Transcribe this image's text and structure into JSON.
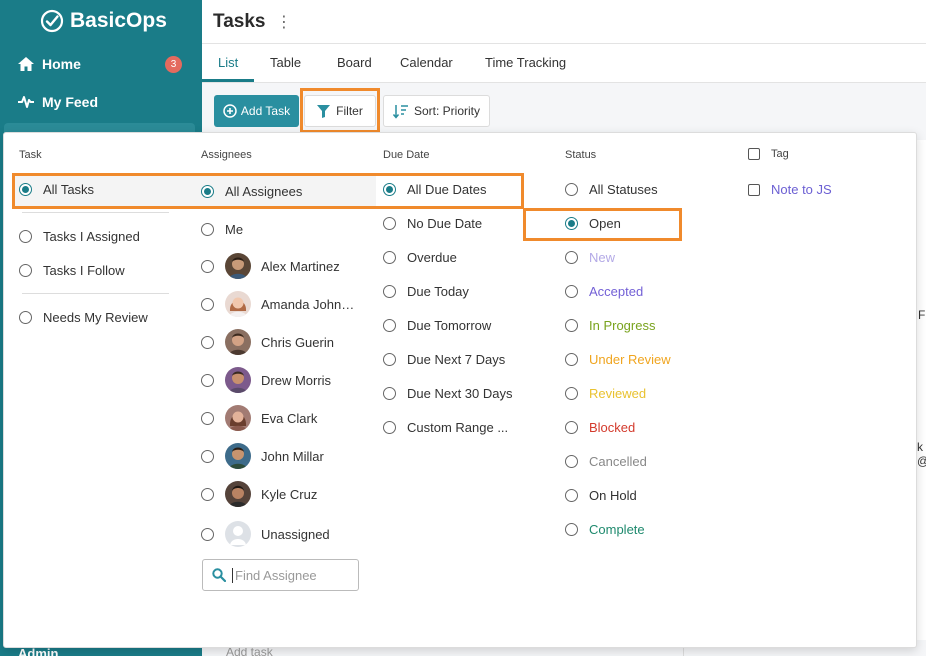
{
  "app": {
    "name": "BasicOps"
  },
  "sidebar": {
    "items": [
      {
        "label": "Home",
        "badge": "3"
      },
      {
        "label": "My Feed"
      }
    ],
    "bottom_label": "Admin"
  },
  "header": {
    "title": "Tasks",
    "more": "⋮"
  },
  "tabs": [
    {
      "label": "List"
    },
    {
      "label": "Table"
    },
    {
      "label": "Board"
    },
    {
      "label": "Calendar"
    },
    {
      "label": "Time Tracking"
    }
  ],
  "toolbar": {
    "add_task": "Add Task",
    "filter": "Filter",
    "sort": "Sort: Priority"
  },
  "background": {
    "letter1": "F",
    "letter2a": "k",
    "letter2b": "@",
    "add_task": "Add task"
  },
  "filter": {
    "task": {
      "heading": "Task",
      "options": [
        "All Tasks",
        "Tasks I Assigned",
        "Tasks I Follow",
        "Needs My Review"
      ]
    },
    "assignees": {
      "heading": "Assignees",
      "options": [
        "All Assignees",
        "Me",
        "Alex Martinez",
        "Amanda John…",
        "Chris Guerin",
        "Drew Morris",
        "Eva Clark",
        "John Millar",
        "Kyle Cruz",
        "Unassigned"
      ],
      "search_placeholder": "Find Assignee"
    },
    "due_date": {
      "heading": "Due Date",
      "options": [
        "All Due Dates",
        "No Due Date",
        "Overdue",
        "Due Today",
        "Due Tomorrow",
        "Due Next 7 Days",
        "Due Next 30 Days",
        "Custom Range ..."
      ]
    },
    "status": {
      "heading": "Status",
      "options": [
        {
          "label": "All Statuses",
          "color": "#333333"
        },
        {
          "label": "Open",
          "color": "#333333"
        },
        {
          "label": "New",
          "color": "#b3a9e6"
        },
        {
          "label": "Accepted",
          "color": "#7360d6"
        },
        {
          "label": "In Progress",
          "color": "#79a31e"
        },
        {
          "label": "Under Review",
          "color": "#f0a51f"
        },
        {
          "label": "Reviewed",
          "color": "#e9c230"
        },
        {
          "label": "Blocked",
          "color": "#d33a2c"
        },
        {
          "label": "Cancelled",
          "color": "#888888"
        },
        {
          "label": "On Hold",
          "color": "#333333"
        },
        {
          "label": "Complete",
          "color": "#1f8a6e"
        }
      ]
    },
    "tag": {
      "heading": "Tag",
      "options": [
        {
          "label": "Note to JS",
          "color": "#6b5fd3"
        }
      ]
    }
  },
  "colors": {
    "brand": "#1a7c88",
    "highlight": "#f08a2c"
  }
}
